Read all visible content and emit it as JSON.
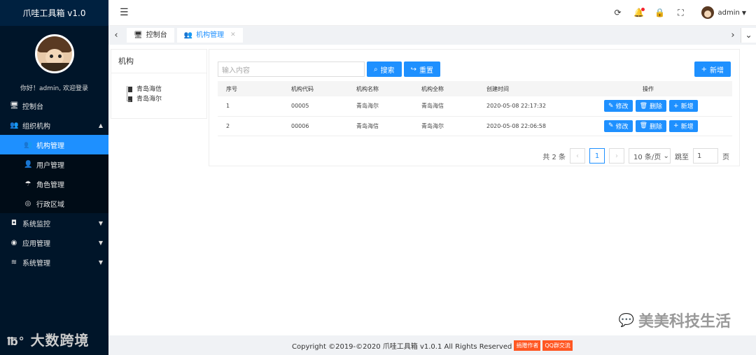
{
  "app_title": "爪哇工具箱 v1.0",
  "welcome": "你好！admin, 欢迎登录",
  "menu": [
    {
      "label": "控制台",
      "icon": "monitor-icon",
      "glyph": "🖥",
      "sub": false
    },
    {
      "label": "组织机构",
      "icon": "users-icon",
      "glyph": "👥",
      "sub": false,
      "caret": "▲"
    },
    {
      "label": "机构管理",
      "icon": "users-icon",
      "glyph": "👥",
      "sub": true,
      "active": true
    },
    {
      "label": "用户管理",
      "icon": "user-icon",
      "glyph": "👤",
      "sub": true
    },
    {
      "label": "角色管理",
      "icon": "umbrella-icon",
      "glyph": "☂",
      "sub": true
    },
    {
      "label": "行政区域",
      "icon": "globe-icon",
      "glyph": "◎",
      "sub": true
    },
    {
      "label": "系统监控",
      "icon": "camera-icon",
      "glyph": "◘",
      "sub": false,
      "caret": "▼"
    },
    {
      "label": "应用管理",
      "icon": "compass-icon",
      "glyph": "◉",
      "sub": false,
      "caret": "▼"
    },
    {
      "label": "系统管理",
      "icon": "layers-icon",
      "glyph": "≋",
      "sub": false,
      "caret": "▼"
    }
  ],
  "brand": "大数跨境",
  "header": {
    "user": "admin"
  },
  "tabs": [
    {
      "label": "控制台",
      "icon": "monitor-icon"
    },
    {
      "label": "机构管理",
      "icon": "users-icon",
      "active": true
    }
  ],
  "tree": {
    "title": "机构",
    "nodes": [
      "青岛海信",
      "青岛海尔"
    ]
  },
  "search": {
    "placeholder": "输入内容",
    "search_label": "搜索",
    "reset_label": "重置",
    "add_label": "新增"
  },
  "table": {
    "headers": [
      "序号",
      "机构代码",
      "机构名称",
      "机构全称",
      "创建时间",
      "操作"
    ],
    "rows": [
      [
        "1",
        "00005",
        "青岛海尔",
        "青岛海信",
        "2020-05-08 22:17:32"
      ],
      [
        "2",
        "00006",
        "青岛海信",
        "青岛海尔",
        "2020-05-08 22:06:58"
      ]
    ],
    "edit_label": "修改",
    "delete_label": "删除",
    "add_label": "新增"
  },
  "pager": {
    "total": "共 2 条",
    "current": "1",
    "page_size": "10 条/页",
    "jump_label": "跳至",
    "jump_value": "1",
    "page_suffix": "页"
  },
  "watermark": "美美科技生活",
  "footer": {
    "copyright": "Copyright ©2019-©2020 爪哇工具箱 v1.0.1 All Rights Reserved",
    "donate": "捐赠作者",
    "qq": "QQ群交流"
  }
}
